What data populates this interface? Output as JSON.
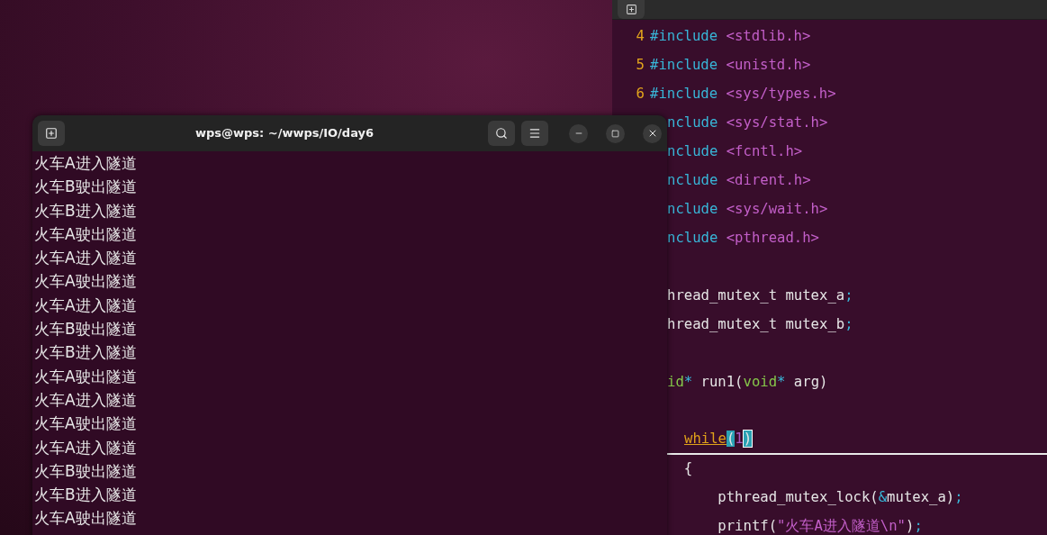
{
  "editor": {
    "lines": [
      {
        "kind": "full",
        "number": "4",
        "tokens": [
          {
            "kind": "directive",
            "text": "#include "
          },
          {
            "kind": "header",
            "text": "<stdlib.h>"
          }
        ]
      },
      {
        "kind": "full",
        "number": "5",
        "tokens": [
          {
            "kind": "directive",
            "text": "#include "
          },
          {
            "kind": "header",
            "text": "<unistd.h>"
          }
        ]
      },
      {
        "kind": "full",
        "number": "6",
        "tokens": [
          {
            "kind": "directive",
            "text": "#include "
          },
          {
            "kind": "header",
            "text": "<sys/types.h>"
          }
        ]
      },
      {
        "kind": "clipped",
        "tokens": [
          {
            "kind": "directive",
            "text": "nclude "
          },
          {
            "kind": "header",
            "text": "<sys/stat.h>"
          }
        ]
      },
      {
        "kind": "clipped",
        "tokens": [
          {
            "kind": "directive",
            "text": "nclude "
          },
          {
            "kind": "header",
            "text": "<fcntl.h>"
          }
        ]
      },
      {
        "kind": "clipped",
        "tokens": [
          {
            "kind": "directive",
            "text": "nclude "
          },
          {
            "kind": "header",
            "text": "<dirent.h>"
          }
        ]
      },
      {
        "kind": "clipped",
        "tokens": [
          {
            "kind": "directive",
            "text": "nclude "
          },
          {
            "kind": "header",
            "text": "<sys/wait.h>"
          }
        ]
      },
      {
        "kind": "clipped",
        "tokens": [
          {
            "kind": "directive",
            "text": "nclude "
          },
          {
            "kind": "header",
            "text": "<pthread.h>"
          }
        ]
      },
      {
        "kind": "blank"
      },
      {
        "kind": "clipped",
        "tokens": [
          {
            "kind": "plain",
            "text": "hread_mutex_t mutex_a"
          },
          {
            "kind": "punct",
            "text": ";"
          }
        ]
      },
      {
        "kind": "clipped",
        "tokens": [
          {
            "kind": "plain",
            "text": "hread_mutex_t mutex_b"
          },
          {
            "kind": "punct",
            "text": ";"
          }
        ]
      },
      {
        "kind": "blank"
      },
      {
        "kind": "clipped",
        "tokens": [
          {
            "kind": "type",
            "text": "id"
          },
          {
            "kind": "punct",
            "text": "*"
          },
          {
            "kind": "plain",
            "text": " run1("
          },
          {
            "kind": "type",
            "text": "void"
          },
          {
            "kind": "punct",
            "text": "*"
          },
          {
            "kind": "plain",
            "text": " arg)"
          }
        ]
      },
      {
        "kind": "blank"
      },
      {
        "kind": "current",
        "tokens": [
          {
            "kind": "keyword",
            "text": "while"
          },
          {
            "kind": "paren_match",
            "text": "("
          },
          {
            "kind": "number",
            "text": "1"
          },
          {
            "kind": "paren_cursor",
            "text": ")"
          }
        ]
      },
      {
        "kind": "clipped",
        "tokens": [
          {
            "kind": "plain",
            "text": "  {"
          }
        ]
      },
      {
        "kind": "clipped",
        "tokens": [
          {
            "kind": "plain",
            "text": "      pthread_mutex_lock("
          },
          {
            "kind": "punct",
            "text": "&"
          },
          {
            "kind": "plain",
            "text": "mutex_a)"
          },
          {
            "kind": "punct",
            "text": ";"
          }
        ]
      },
      {
        "kind": "clipped",
        "tokens": [
          {
            "kind": "plain",
            "text": "      printf("
          },
          {
            "kind": "header",
            "text": "\"火车A进入隧道\\n\""
          },
          {
            "kind": "plain",
            "text": ")"
          },
          {
            "kind": "punct",
            "text": ";"
          }
        ]
      }
    ]
  },
  "terminal": {
    "title": "wps@wps: ~/wwps/IO/day6",
    "output": [
      "火车A进入隧道",
      "火车B驶出隧道",
      "火车B进入隧道",
      "火车A驶出隧道",
      "火车A进入隧道",
      "火车A驶出隧道",
      "火车A进入隧道",
      "火车B驶出隧道",
      "火车B进入隧道",
      "火车A驶出隧道",
      "火车A进入隧道",
      "火车A驶出隧道",
      "火车A进入隧道",
      "火车B驶出隧道",
      "火车B进入隧道",
      "火车A驶出隧道"
    ]
  }
}
